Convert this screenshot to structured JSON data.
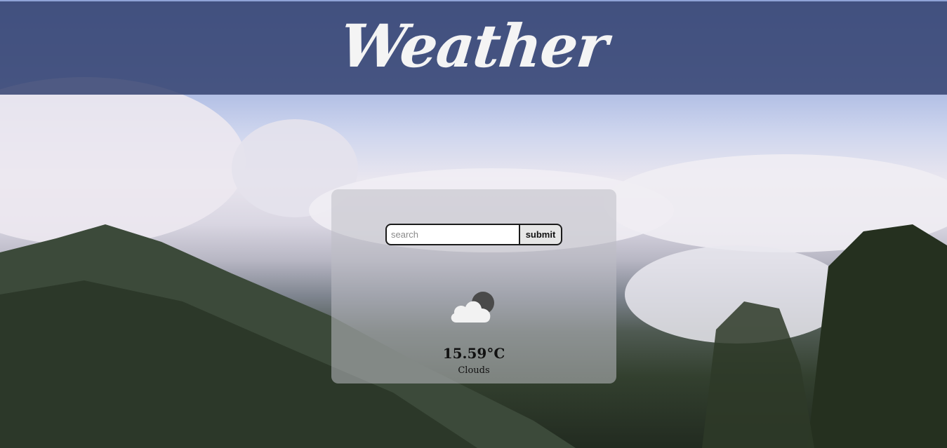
{
  "header": {
    "title": "Weather"
  },
  "search": {
    "placeholder": "search",
    "value": "",
    "submit_label": "submit"
  },
  "weather": {
    "icon": "cloudy-night-icon",
    "temperature": "15.59°C",
    "description": "Clouds"
  },
  "colors": {
    "header_bg": "#344270",
    "logo_text": "#f4f4f4",
    "card_bg": "#bebec4"
  }
}
